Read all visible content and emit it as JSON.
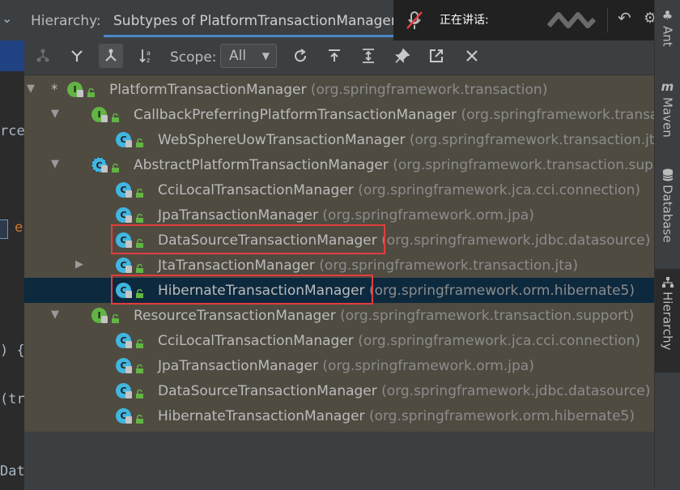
{
  "editor": {
    "fragments": [
      "rce",
      "e",
      ") {",
      "(tr",
      "Dat"
    ]
  },
  "header": {
    "title": "Hierarchy:",
    "tab_label": "Subtypes of PlatformTransactionManager",
    "speaking_label": "正在讲话:"
  },
  "toolbar": {
    "scope_label": "Scope:",
    "scope_value": "All",
    "buttons": [
      "supertypes-hierarchy-icon",
      "subtypes-hierarchy-icon",
      "class-hierarchy-icon",
      "sort-alphabetically-icon",
      "refresh-icon",
      "export-icon",
      "expand-all-icon",
      "pin-icon",
      "open-in-window-icon",
      "close-icon"
    ]
  },
  "tree": {
    "rows": [
      {
        "marker": "*",
        "name": "PlatformTransactionManager",
        "pkg": "(org.springframework.transaction)",
        "kind": "interface",
        "level": 0,
        "expander": "expanded"
      },
      {
        "marker": "",
        "name": "CallbackPreferringPlatformTransactionManager",
        "pkg": "(org.springframework.transaction.s",
        "kind": "interface",
        "level": 1,
        "expander": "expanded"
      },
      {
        "marker": "",
        "name": "WebSphereUowTransactionManager",
        "pkg": "(org.springframework.transaction.jta)",
        "kind": "class",
        "level": 2,
        "expander": "none"
      },
      {
        "marker": "",
        "name": "AbstractPlatformTransactionManager",
        "pkg": "(org.springframework.transaction.support)",
        "kind": "abstract",
        "level": 1,
        "expander": "expanded"
      },
      {
        "marker": "",
        "name": "CciLocalTransactionManager",
        "pkg": "(org.springframework.jca.cci.connection)",
        "kind": "class",
        "level": 2,
        "expander": "none"
      },
      {
        "marker": "",
        "name": "JpaTransactionManager",
        "pkg": "(org.springframework.orm.jpa)",
        "kind": "class",
        "level": 2,
        "expander": "none"
      },
      {
        "marker": "",
        "name": "DataSourceTransactionManager",
        "pkg": "(org.springframework.jdbc.datasource)",
        "kind": "class",
        "level": 2,
        "expander": "none",
        "highlighted": true
      },
      {
        "marker": "",
        "name": "JtaTransactionManager",
        "pkg": "(org.springframework.transaction.jta)",
        "kind": "class",
        "level": 2,
        "expander": "collapsed"
      },
      {
        "marker": "",
        "name": "HibernateTransactionManager",
        "pkg": "(org.springframework.orm.hibernate5)",
        "kind": "class",
        "level": 2,
        "expander": "none",
        "highlighted": true,
        "selected": true
      },
      {
        "marker": "",
        "name": "ResourceTransactionManager",
        "pkg": "(org.springframework.transaction.support)",
        "kind": "interface",
        "level": 1,
        "expander": "expanded"
      },
      {
        "marker": "",
        "name": "CciLocalTransactionManager",
        "pkg": "(org.springframework.jca.cci.connection)",
        "kind": "class",
        "level": 2,
        "expander": "none"
      },
      {
        "marker": "",
        "name": "JpaTransactionManager",
        "pkg": "(org.springframework.orm.jpa)",
        "kind": "class",
        "level": 2,
        "expander": "none"
      },
      {
        "marker": "",
        "name": "DataSourceTransactionManager",
        "pkg": "(org.springframework.jdbc.datasource)",
        "kind": "class",
        "level": 2,
        "expander": "none"
      },
      {
        "marker": "",
        "name": "HibernateTransactionManager",
        "pkg": "(org.springframework.orm.hibernate5)",
        "kind": "class",
        "level": 2,
        "expander": "none"
      }
    ]
  },
  "right_strip": {
    "tabs": [
      {
        "label": "Ant",
        "icon": "ant-icon"
      },
      {
        "label": "Maven",
        "icon": "maven-icon"
      },
      {
        "label": "Database",
        "icon": "database-icon"
      },
      {
        "label": "Hierarchy",
        "icon": "hierarchy-icon",
        "active": true
      }
    ]
  },
  "colors": {
    "highlight_box": "#e33d3d",
    "selected_row": "#0d293e",
    "tree_background": "#4f4b41",
    "interface_icon": "#62b543",
    "class_icon": "#40b6e0"
  }
}
